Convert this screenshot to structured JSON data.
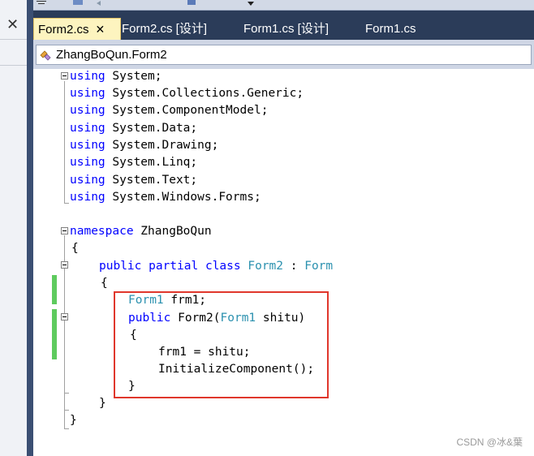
{
  "toolbar": {
    "icons": [
      "align-left-icon",
      "align-center-icon",
      "undo-icon",
      "redo-icon",
      "bookmark-icon",
      "dropdown-icon"
    ]
  },
  "left_panel": {
    "close_label": "✕"
  },
  "tabs": [
    {
      "label": "Form2.cs",
      "active": true,
      "close": "✕"
    },
    {
      "label": "Form2.cs [设计]",
      "active": false
    },
    {
      "label": "Form1.cs [设计]",
      "active": false
    },
    {
      "label": "Form1.cs",
      "active": false
    }
  ],
  "breadcrumb": {
    "label": "ZhangBoQun.Form2"
  },
  "code": {
    "l1_kw": "using",
    "l1_rest": " System;",
    "l2_kw": "using",
    "l2_rest": " System.Collections.Generic;",
    "l3_kw": "using",
    "l3_rest": " System.ComponentModel;",
    "l4_kw": "using",
    "l4_rest": " System.Data;",
    "l5_kw": "using",
    "l5_rest": " System.Drawing;",
    "l6_kw": "using",
    "l6_rest": " System.Linq;",
    "l7_kw": "using",
    "l7_rest": " System.Text;",
    "l8_kw": "using",
    "l8_rest": " System.Windows.Forms;",
    "l10_kw": "namespace",
    "l10_rest": " ZhangBoQun",
    "l11": "{",
    "l12_kw1": "public",
    "l12_kw2": " partial",
    "l12_kw3": " class",
    "l12_ty": " Form2",
    "l12_colon": " :",
    "l12_base": " Form",
    "l13": "{",
    "l14_ty": "Form1",
    "l14_rest": " frm1;",
    "l15_kw": "public",
    "l15_name": " Form2(",
    "l15_ty": "Form1",
    "l15_rest": " shitu)",
    "l16": "{",
    "l17": "frm1 = shitu;",
    "l18": "InitializeComponent();",
    "l19": "}",
    "l20": "}",
    "l21": "}"
  },
  "watermark": "CSDN @冰&葉",
  "colors": {
    "keyword": "#0000ff",
    "type": "#2b91af",
    "tab_active_bg": "#fdf4bf",
    "tabbar_bg": "#2b3c59",
    "highlight_border": "#e0372c"
  }
}
